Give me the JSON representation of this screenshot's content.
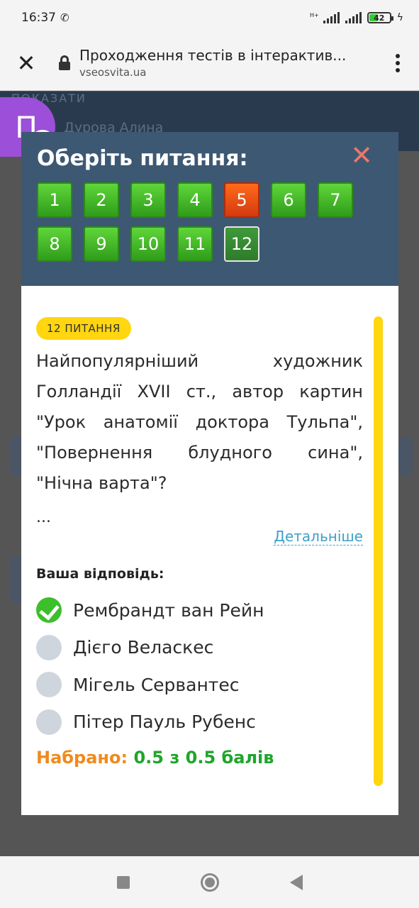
{
  "status_bar": {
    "time": "16:37",
    "network_type": "H+",
    "battery_level": "42"
  },
  "browser": {
    "page_title": "Проходження тестів в інтерактив...",
    "domain": "vseosvita.ua"
  },
  "background": {
    "show_label": "ПОКАЗАТИ",
    "user_name": "Дурова Алина",
    "avatar_letter": "П"
  },
  "modal": {
    "title": "Оберіть питання:",
    "question_numbers": [
      {
        "n": "1",
        "state": "correct"
      },
      {
        "n": "2",
        "state": "correct"
      },
      {
        "n": "3",
        "state": "correct"
      },
      {
        "n": "4",
        "state": "correct"
      },
      {
        "n": "5",
        "state": "wrong"
      },
      {
        "n": "6",
        "state": "correct"
      },
      {
        "n": "7",
        "state": "correct"
      },
      {
        "n": "8",
        "state": "correct"
      },
      {
        "n": "9",
        "state": "correct"
      },
      {
        "n": "10",
        "state": "correct"
      },
      {
        "n": "11",
        "state": "correct"
      },
      {
        "n": "12",
        "state": "current"
      }
    ],
    "question_badge": "12 ПИТАННЯ",
    "question_text": "Найпопулярніший художник Голландії XVII ст., автор картин \"Урок анатомії доктора Тульпа\", \"Повернення блудного сина\", \"Нічна варта\"?",
    "ellipsis": "...",
    "details_link": "Детальніше",
    "your_answer_label": "Ваша відповідь:",
    "options": [
      {
        "label": "Рембрандт ван Рейн",
        "checked": true
      },
      {
        "label": "Дієго Веласкес",
        "checked": false
      },
      {
        "label": "Мігель Сервантес",
        "checked": false
      },
      {
        "label": "Пітер Пауль Рубенс",
        "checked": false
      }
    ],
    "score_label": "Набрано:",
    "score_value": "0.5 з 0.5 балів"
  },
  "colors": {
    "header": "#3d5872",
    "badge": "#ffd60f",
    "correct": "#3bbf2a",
    "wrong": "#e0431a",
    "score_label": "#f08a1c",
    "score_value": "#1fa52a"
  }
}
